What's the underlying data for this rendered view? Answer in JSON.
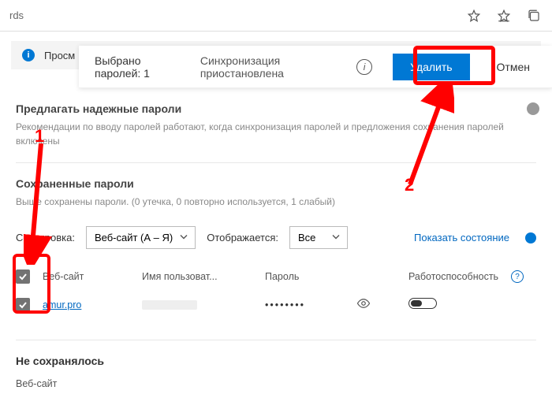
{
  "url_bar": {
    "fragment": "rds"
  },
  "info_banner": {
    "text_visible": "Просм"
  },
  "selection_bar": {
    "count_text": "Выбрано паролей: 1",
    "sync_text": "Синхронизация приостановлена",
    "delete_label": "Удалить",
    "cancel_label": "Отмен"
  },
  "suggest_section": {
    "title": "Предлагать надежные пароли",
    "desc": "Рекомендации по вводу паролей работают, когда синхронизация паролей и предложения сохранения паролей включены"
  },
  "saved_section": {
    "title": "Сохраненные пароли",
    "desc": "Выше сохранены пароли. (0 утечка, 0 повторно используется, 1 слабый)",
    "sort_label": "Сортировка:",
    "sort_value": "Веб-сайт (А – Я)",
    "display_label": "Отображается:",
    "display_value": "Все",
    "show_health": "Показать состояние"
  },
  "table": {
    "headers": {
      "site": "Веб-сайт",
      "user": "Имя пользоват...",
      "pass": "Пароль",
      "health": "Работоспособность"
    },
    "rows": [
      {
        "site": "amur.pro",
        "password_mask": "••••••••"
      }
    ]
  },
  "not_saved": {
    "title": "Не сохранялось",
    "col_site": "Веб-сайт"
  },
  "annotations": {
    "label1": "1",
    "label2": "2"
  }
}
